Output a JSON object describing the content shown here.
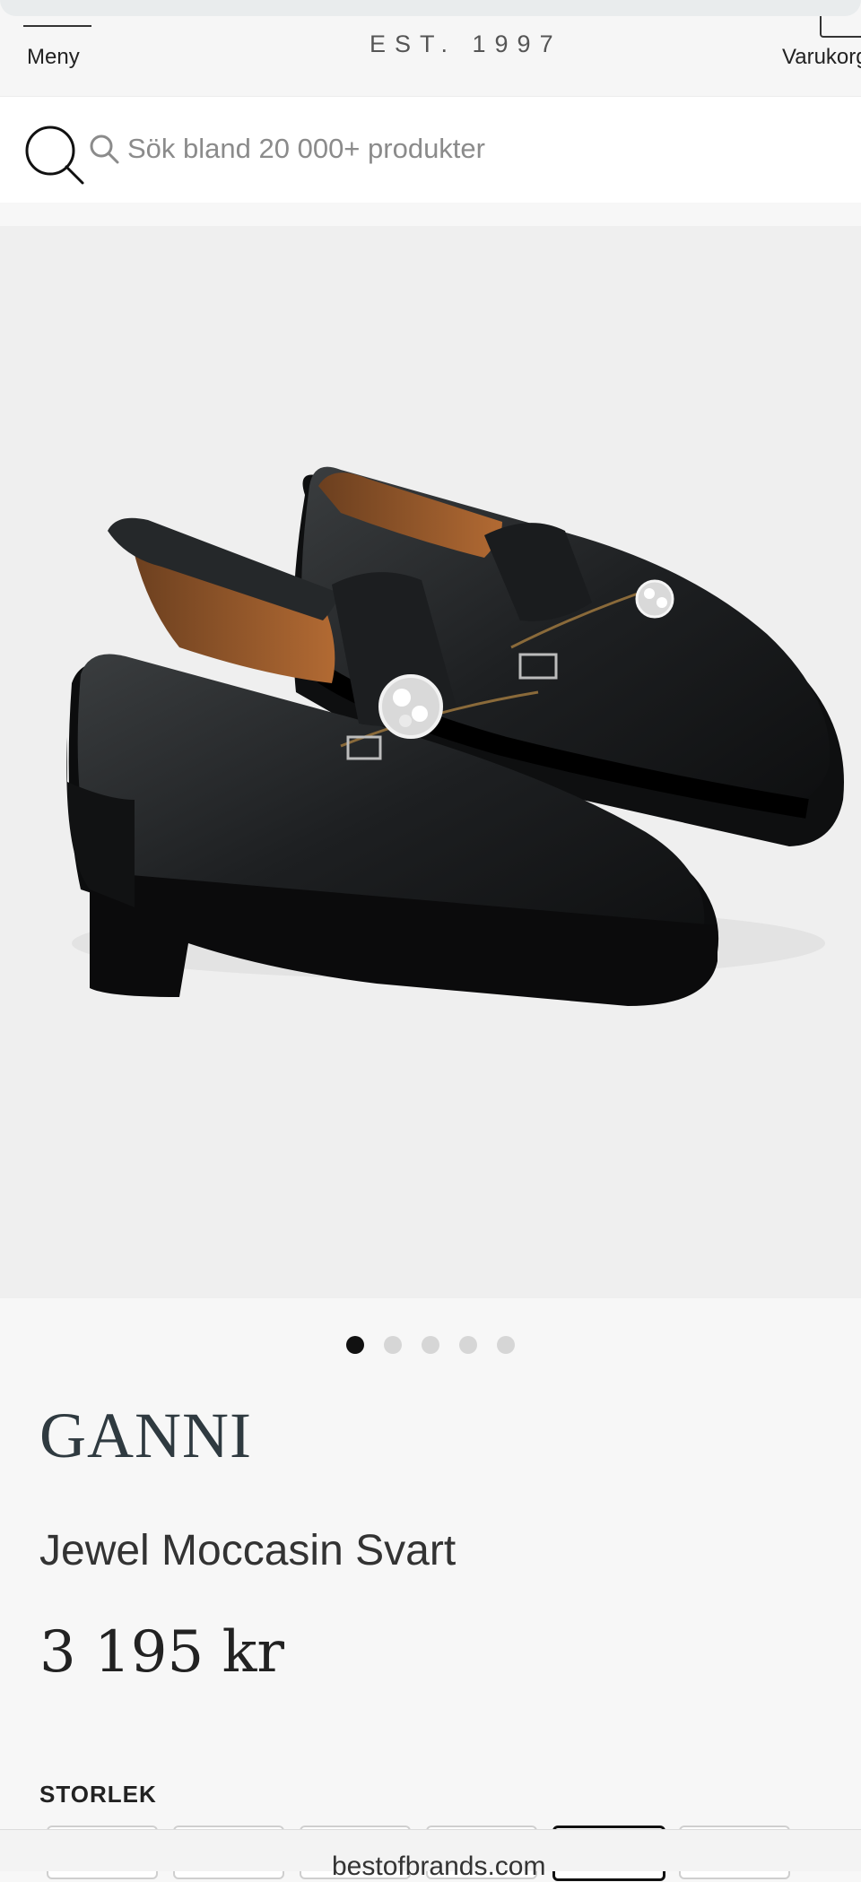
{
  "header": {
    "menu_label": "Meny",
    "est_text": "EST. 1997",
    "cart_label": "Varukorg"
  },
  "search": {
    "placeholder": "Sök bland 20 000+ produkter"
  },
  "gallery": {
    "image_count": 5,
    "active_index": 0
  },
  "product": {
    "brand": "GANNI",
    "name": "Jewel Moccasin Svart",
    "price": "3 195 kr"
  },
  "size": {
    "heading": "STORLEK",
    "selected_index": 4
  },
  "browser": {
    "url": "bestofbrands.com"
  }
}
